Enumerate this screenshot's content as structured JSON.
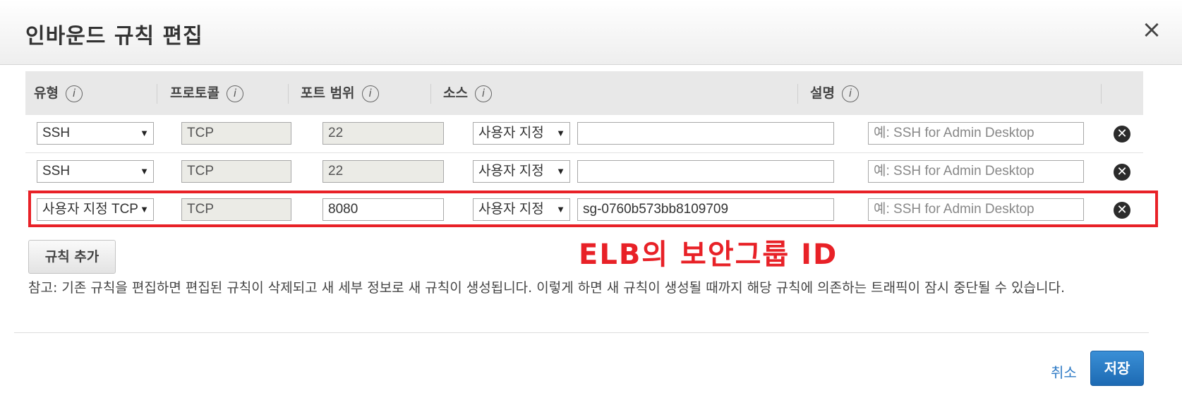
{
  "dialog": {
    "title": "인바운드 규칙 편집",
    "close_label": "×"
  },
  "table": {
    "headers": {
      "type": "유형",
      "protocol": "프로토콜",
      "port_range": "포트 범위",
      "source": "소스",
      "description": "설명",
      "info_glyph": "i"
    },
    "rows": [
      {
        "type": "SSH",
        "protocol": "TCP",
        "port_range": "22",
        "source_type": "사용자 지정",
        "source_value": "",
        "description_placeholder": "예: SSH for Admin Desktop"
      },
      {
        "type": "SSH",
        "protocol": "TCP",
        "port_range": "22",
        "source_type": "사용자 지정",
        "source_value": "",
        "description_placeholder": "예: SSH for Admin Desktop"
      },
      {
        "type": "사용자 지정 TCP",
        "protocol": "TCP",
        "port_range": "8080",
        "source_type": "사용자 지정",
        "source_value": "sg-0760b573bb8109709",
        "description_placeholder": "예: SSH for Admin Desktop"
      }
    ],
    "dropdown_arrow": "▼",
    "remove_glyph": "✕"
  },
  "add_rule_label": "규칙 추가",
  "annotation": "ELB의 보안그룹 ID",
  "note": "참고: 기존 규칙을 편집하면 편집된 규칙이 삭제되고 새 세부 정보로 새 규칙이 생성됩니다. 이렇게 하면 새 규칙이 생성될 때까지 해당 규칙에 의존하는 트래픽이 잠시 중단될 수 있습니다.",
  "footer": {
    "cancel_label": "취소",
    "save_label": "저장"
  },
  "colors": {
    "annotation": "#e82127",
    "save_button": "#1d6ab3",
    "link": "#2f7bc6"
  }
}
